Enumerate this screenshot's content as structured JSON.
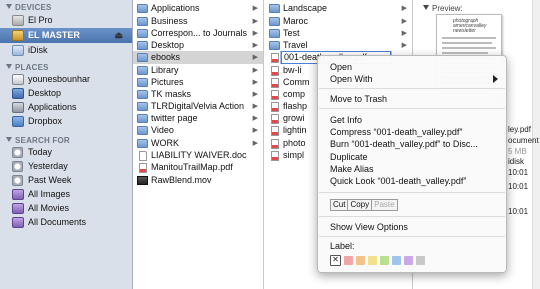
{
  "sidebar": {
    "devices_header": "DEVICES",
    "places_header": "PLACES",
    "search_header": "SEARCH FOR",
    "devices": [
      {
        "label": "El Pro",
        "icon": "disk-icon"
      },
      {
        "label": "EL MASTER",
        "icon": "disk-icon",
        "selected": true,
        "eject": "⏏"
      },
      {
        "label": "iDisk",
        "icon": "idisk-icon"
      }
    ],
    "places": [
      {
        "label": "younesbounhar",
        "icon": "home-icon"
      },
      {
        "label": "Desktop",
        "icon": "desktop-icon"
      },
      {
        "label": "Applications",
        "icon": "applications-icon"
      },
      {
        "label": "Dropbox",
        "icon": "dropbox-icon"
      }
    ],
    "searches": [
      {
        "label": "Today",
        "icon": "clock-icon"
      },
      {
        "label": "Yesterday",
        "icon": "clock-icon"
      },
      {
        "label": "Past Week",
        "icon": "clock-icon"
      },
      {
        "label": "All Images",
        "icon": "smart-folder-icon"
      },
      {
        "label": "All Movies",
        "icon": "smart-folder-icon"
      },
      {
        "label": "All Documents",
        "icon": "smart-folder-icon"
      }
    ]
  },
  "column1": {
    "items": [
      {
        "label": "Applications",
        "kind": "folder"
      },
      {
        "label": "Business",
        "kind": "folder"
      },
      {
        "label": "Correspon... to Journals",
        "kind": "folder"
      },
      {
        "label": "Desktop",
        "kind": "folder"
      },
      {
        "label": "ebooks",
        "kind": "folder",
        "highlighted": true
      },
      {
        "label": "Library",
        "kind": "folder"
      },
      {
        "label": "Pictures",
        "kind": "folder"
      },
      {
        "label": "TK masks",
        "kind": "folder"
      },
      {
        "label": "TLRDigitalVelvia Action",
        "kind": "folder"
      },
      {
        "label": "twitter page",
        "kind": "folder"
      },
      {
        "label": "Video",
        "kind": "folder"
      },
      {
        "label": "WORK",
        "kind": "folder"
      },
      {
        "label": "LIABILITY WAIVER.doc",
        "kind": "doc"
      },
      {
        "label": "ManitouTrailMap.pdf",
        "kind": "pdf"
      },
      {
        "label": "RawBlend.mov",
        "kind": "mov"
      }
    ]
  },
  "column2": {
    "items": [
      {
        "label": "Landscape",
        "kind": "folder"
      },
      {
        "label": "Maroc",
        "kind": "folder"
      },
      {
        "label": "Test",
        "kind": "folder"
      },
      {
        "label": "Travel",
        "kind": "folder"
      },
      {
        "label": "001-death_valley.pdf",
        "kind": "pdf",
        "editing": true
      },
      {
        "label": "bw-li",
        "kind": "pdf"
      },
      {
        "label": "Comm",
        "kind": "pdf"
      },
      {
        "label": "comp",
        "kind": "pdf"
      },
      {
        "label": "flashp",
        "kind": "pdf"
      },
      {
        "label": "growi",
        "kind": "pdf"
      },
      {
        "label": "lightin",
        "kind": "pdf"
      },
      {
        "label": "photo",
        "kind": "pdf"
      },
      {
        "label": "simpl",
        "kind": "pdf"
      }
    ]
  },
  "preview": {
    "label": "Preview:",
    "thumb_title": "photograph americanvalley newsletter",
    "meta_lines": [
      "ley.pdf",
      "ocument",
      "5 MB",
      "idisk",
      "10:01",
      "10:01",
      "10:01"
    ]
  },
  "context_menu": {
    "open": "Open",
    "open_with": "Open With",
    "move_to_trash": "Move to Trash",
    "get_info": "Get Info",
    "compress": "Compress “001-death_valley.pdf”",
    "burn": "Burn “001-death_valley.pdf” to Disc...",
    "duplicate": "Duplicate",
    "make_alias": "Make Alias",
    "quick_look": "Quick Look “001-death_valley.pdf”",
    "cut": "Cut",
    "copy": "Copy",
    "paste": "Paste",
    "show_view_options": "Show View Options",
    "label_title": "Label:",
    "label_none": "✕",
    "label_colors": [
      "#f0a6a6",
      "#f4c287",
      "#f3e08a",
      "#b9e08e",
      "#9fc4ee",
      "#c9a9e6",
      "#c8c8c8"
    ]
  }
}
